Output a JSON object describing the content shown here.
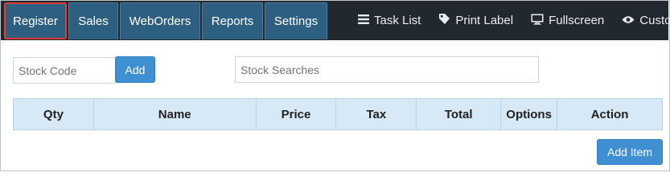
{
  "nav": {
    "tabs": [
      {
        "label": "Register",
        "active": true
      },
      {
        "label": "Sales",
        "active": false
      },
      {
        "label": "WebOrders",
        "active": false
      },
      {
        "label": "Reports",
        "active": false
      },
      {
        "label": "Settings",
        "active": false
      }
    ],
    "right_menu": [
      {
        "label": "Task List",
        "icon": "list-icon"
      },
      {
        "label": "Print Label",
        "icon": "tag-icon"
      },
      {
        "label": "Fullscreen",
        "icon": "monitor-icon"
      },
      {
        "label": "Customer",
        "icon": "eye-icon"
      }
    ]
  },
  "register": {
    "stock_code_placeholder": "Stock Code",
    "add_label": "Add",
    "stock_search_placeholder": "Stock Searches",
    "table_headers": [
      "Qty",
      "Name",
      "Price",
      "Tax",
      "Total",
      "Options",
      "Action"
    ],
    "add_item_label": "Add Item"
  },
  "colors": {
    "topbar": "#22292e",
    "tab": "#2d5f80",
    "active_outline": "#e23b3b",
    "button": "#3f8fd2",
    "table_header": "#d7e8f6"
  }
}
